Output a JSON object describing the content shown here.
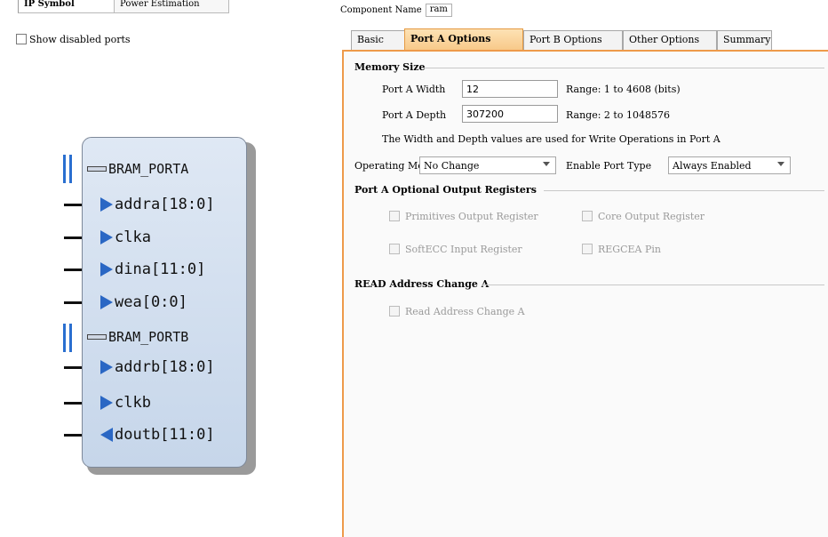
{
  "left_tabs": [
    "IP Symbol",
    "Power Estimation"
  ],
  "show_disabled_ports": {
    "label": "Show disabled ports",
    "checked": false
  },
  "symbol": {
    "bus_a": "BRAM_PORTA",
    "ports_a": [
      {
        "name": "addra[18:0]",
        "dir": "in"
      },
      {
        "name": "clka",
        "dir": "in"
      },
      {
        "name": "dina[11:0]",
        "dir": "in"
      },
      {
        "name": "wea[0:0]",
        "dir": "in"
      }
    ],
    "bus_b": "BRAM_PORTB",
    "ports_b": [
      {
        "name": "addrb[18:0]",
        "dir": "in"
      },
      {
        "name": "clkb",
        "dir": "in"
      },
      {
        "name": "doutb[11:0]",
        "dir": "out"
      }
    ]
  },
  "component_name": {
    "label": "Component Name",
    "value": "ram"
  },
  "option_tabs": [
    "Basic",
    "Port A Options",
    "Port B Options",
    "Other Options",
    "Summary"
  ],
  "active_tab": "Port A Options",
  "memory_size": {
    "title": "Memory Size",
    "width_label": "Port A Width",
    "width_value": "12",
    "width_range": "Range: 1 to 4608 (bits)",
    "depth_label": "Port A Depth",
    "depth_value": "307200",
    "depth_range": "Range: 2 to 1048576",
    "note": "The Width and Depth values are used for Write Operations in Port A"
  },
  "operating_mode": {
    "label": "Operating Mode",
    "value": "No Change"
  },
  "enable_port_type": {
    "label": "Enable Port Type",
    "value": "Always Enabled"
  },
  "optional_registers": {
    "title": "Port A Optional Output Registers",
    "primitives": "Primitives Output Register",
    "core": "Core Output Register",
    "softecc": "SoftECC Input Register",
    "regcea": "REGCEA Pin"
  },
  "read_address_change": {
    "title": "READ Address Change A",
    "checkbox": "Read Address Change A"
  },
  "colors": {
    "accent": "#ee9a4a",
    "pin_arrow": "#2a67c4",
    "symbol_fill": "#cfdcee"
  }
}
